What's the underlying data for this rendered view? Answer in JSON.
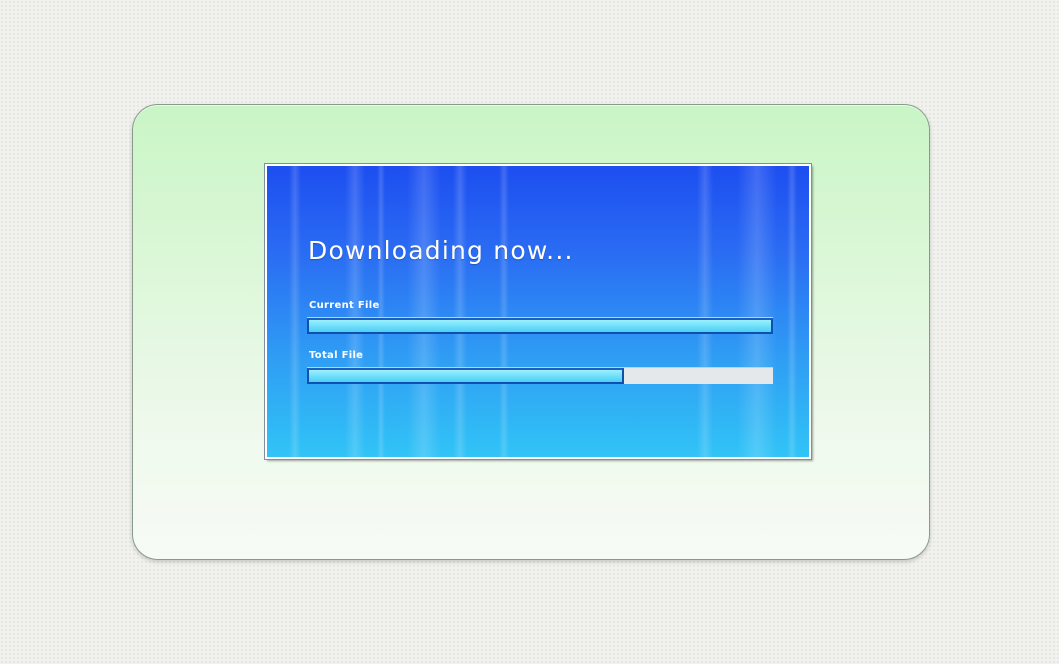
{
  "dialog": {
    "title": "Downloading now...",
    "current_file_label": "Current File",
    "total_file_label": "Total File",
    "current_file_progress": 1.0,
    "total_file_progress": 0.68
  },
  "colors": {
    "screen_top": "#1d4ef0",
    "screen_bottom": "#31c4f6",
    "frame_top": "#c9f5c6",
    "bar_fill": "#6fe0fb",
    "bar_border": "#0f4fae",
    "bar_track": "#e4e8ea"
  }
}
